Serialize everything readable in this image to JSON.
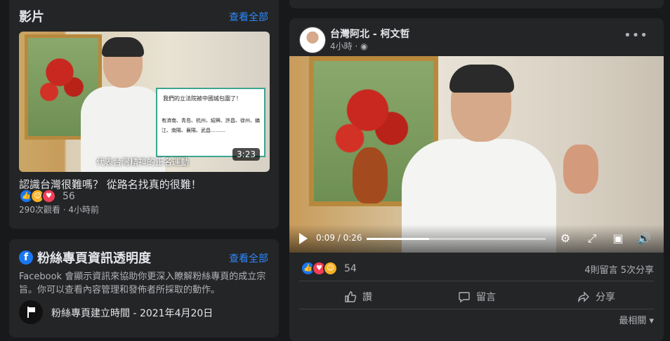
{
  "videos": {
    "heading": "影片",
    "see_all": "查看全部",
    "sign_title": "我們的立法院被中國城包圍了！",
    "sign_list": "有濟南、青島、杭州、紹興、許昌、徐州、鎮江、南陽、襄陽、武昌………",
    "subtitle": "代表台灣精神的正名運動",
    "duration": "3:23",
    "title": "認識台灣很難嗎？ 從路名找真的很難！",
    "reaction_count": "56",
    "meta": "290次觀看 · 4小時前"
  },
  "transparency": {
    "heading": "粉絲專頁資訊透明度",
    "see_all": "查看全部",
    "description": "Facebook 會顯示資訊來協助你更深入瞭解粉絲專頁的成立宗旨。你可以查看內容管理和發佈者所採取的動作。",
    "created": "粉絲專頁建立時間 - 2021年4月20日"
  },
  "post": {
    "page_name": "台灣阿北 - 柯文哲",
    "time": "4小時 · ",
    "video_time": "0:09 / 0:26",
    "progress": 0.35,
    "reaction_count": "54",
    "stats": "4則留言  5次分享",
    "actions": {
      "like": "讚",
      "comment": "留言",
      "share": "分享"
    },
    "sort": "最相關 ▾"
  },
  "icons": [
    "play-icon",
    "settings-icon",
    "fullscreen-icon",
    "miniplayer-icon",
    "volume-icon",
    "more-icon",
    "globe-icon",
    "flag-icon"
  ],
  "colors": {
    "background": "#18191a",
    "card": "#242526",
    "link": "#2d88ff",
    "like": "#1877f2",
    "love": "#f33e58",
    "haha": "#f7b125"
  }
}
